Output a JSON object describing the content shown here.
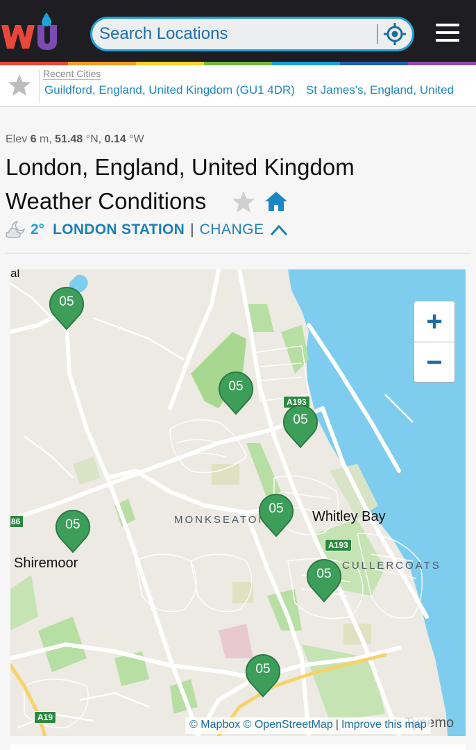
{
  "header": {
    "logo_name": "wunderground-logo",
    "search_placeholder": "Search Locations",
    "rainbow_colors": [
      "#e8483a",
      "#f39c27",
      "#f7d02c",
      "#74b840",
      "#1aa0d9",
      "#2360b0",
      "#8d4bb0"
    ]
  },
  "recent": {
    "label": "Recent Cities",
    "cities": [
      "Guildford, England, United Kingdom (GU1 4DR)",
      "St James's, England, United"
    ]
  },
  "location": {
    "elev_prefix": "Elev",
    "elev_value": "6",
    "elev_unit": "m,",
    "lat_value": "51.48",
    "lat_unit": "°N,",
    "lon_value": "0.14",
    "lon_unit": "°W",
    "title_line1": "London, England, United Kingdom",
    "title_line2": "Weather Conditions",
    "temp": "2°",
    "station": "LONDON STATION",
    "separator": "|",
    "change": "CHANGE"
  },
  "map": {
    "pin_label": "05",
    "labels": {
      "whitley_bay": "Whitley Bay",
      "monkseaton": "MONKSEATON",
      "cullercoats": "CULLERCOATS",
      "shiremoor": "Shiremoor",
      "tynemo": "Tynemo",
      "top_left_fragment": "al"
    },
    "shields": {
      "a193_top": "A193",
      "a193_mid": "A193",
      "a19": "A19",
      "a186": "86"
    },
    "attribution": {
      "mapbox": "© Mapbox",
      "osm": "© OpenStreetMap",
      "separator": "|",
      "improve": "Improve this map"
    },
    "colors": {
      "sea": "#7ecdef",
      "land": "#eceae3",
      "park": "#a8d890",
      "pin": "#3d9e5a",
      "road": "#ffffff"
    }
  }
}
